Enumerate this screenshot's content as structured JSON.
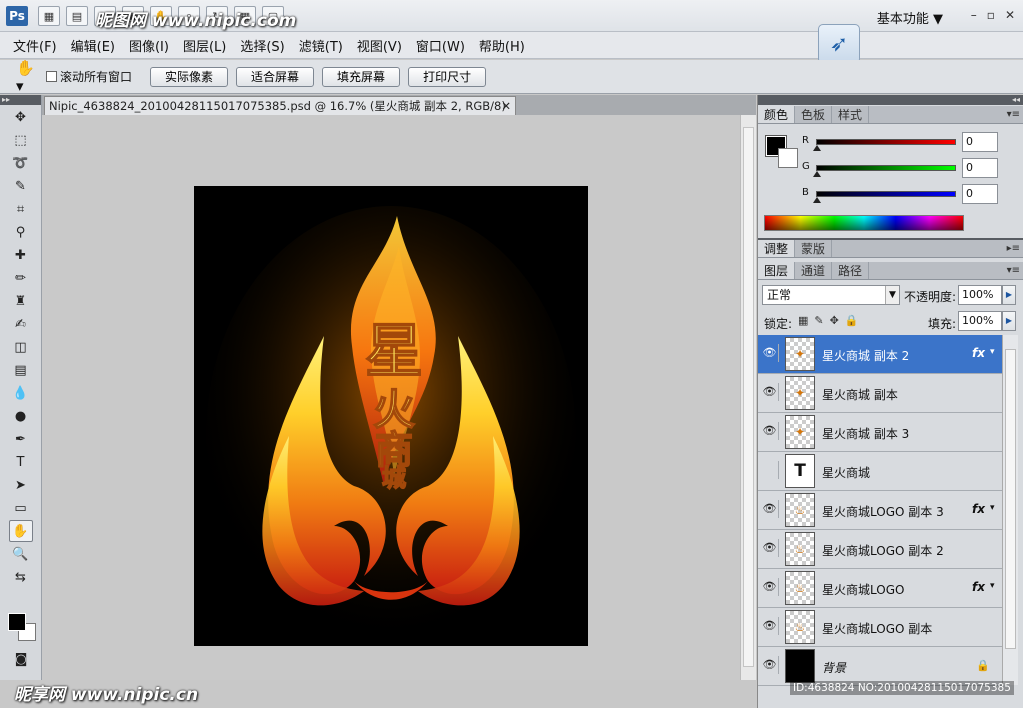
{
  "title_bar": {
    "logo": "Ps",
    "watermark": "昵图网 www.nipic.com",
    "workspace": "基本功能 ▼",
    "min": "–",
    "restore": "▫",
    "close": "✕"
  },
  "menu": [
    "文件(F)",
    "编辑(E)",
    "图像(I)",
    "图层(L)",
    "选择(S)",
    "滤镜(T)",
    "视图(V)",
    "窗口(W)",
    "帮助(H)"
  ],
  "options": {
    "scroll_all_label": "滚动所有窗口",
    "actual_pixels": "实际像素",
    "fit_screen": "适合屏幕",
    "fill_screen": "填充屏幕",
    "print_size": "打印尺寸"
  },
  "document": {
    "tab_title": "Nipic_4638824_20100428115017075385.psd @ 16.7% (星火商城 副本 2, RGB/8)",
    "close": "✕",
    "canvas_text": [
      "星",
      "火",
      "商",
      "城"
    ]
  },
  "color_panel": {
    "tabs": [
      "颜色",
      "色板",
      "样式"
    ],
    "channels": [
      {
        "label": "R",
        "value": "0",
        "color": "#d93a3a"
      },
      {
        "label": "G",
        "value": "0",
        "color": "#3aa83a"
      },
      {
        "label": "B",
        "value": "0",
        "color": "#2b2bb8"
      }
    ]
  },
  "adjust_tabs": [
    "调整",
    "蒙版"
  ],
  "layers_panel": {
    "tabs": [
      "图层",
      "通道",
      "路径"
    ],
    "blend_mode": "正常",
    "opacity_label": "不透明度:",
    "opacity": "100%",
    "lock_label": "锁定:",
    "fill_label": "填充:",
    "fill": "100%",
    "layers": [
      {
        "name": "星火商城 副本 2",
        "selected": true,
        "fx": "fx",
        "visible": true,
        "thumb": "✦"
      },
      {
        "name": "星火商城 副本",
        "selected": false,
        "fx": "",
        "visible": true,
        "thumb": "✦"
      },
      {
        "name": "星火商城 副本 3",
        "selected": false,
        "fx": "",
        "visible": true,
        "thumb": "✦"
      },
      {
        "name": "星火商城",
        "selected": false,
        "fx": "",
        "visible": false,
        "thumb": "T"
      },
      {
        "name": "星火商城LOGO 副本 3",
        "selected": false,
        "fx": "fx",
        "visible": true,
        "thumb": "♨"
      },
      {
        "name": "星火商城LOGO 副本 2",
        "selected": false,
        "fx": "",
        "visible": true,
        "thumb": "♨"
      },
      {
        "name": "星火商城LOGO",
        "selected": false,
        "fx": "fx",
        "visible": true,
        "thumb": "♨"
      },
      {
        "name": "星火商城LOGO 副本",
        "selected": false,
        "fx": "",
        "visible": true,
        "thumb": "♨"
      },
      {
        "name": "背景",
        "selected": false,
        "fx": "",
        "visible": true,
        "thumb": ""
      }
    ]
  },
  "footer": {
    "watermark": "昵享网 www.nipic.cn",
    "id": "ID:4638824 NO:20100428115017075385"
  }
}
